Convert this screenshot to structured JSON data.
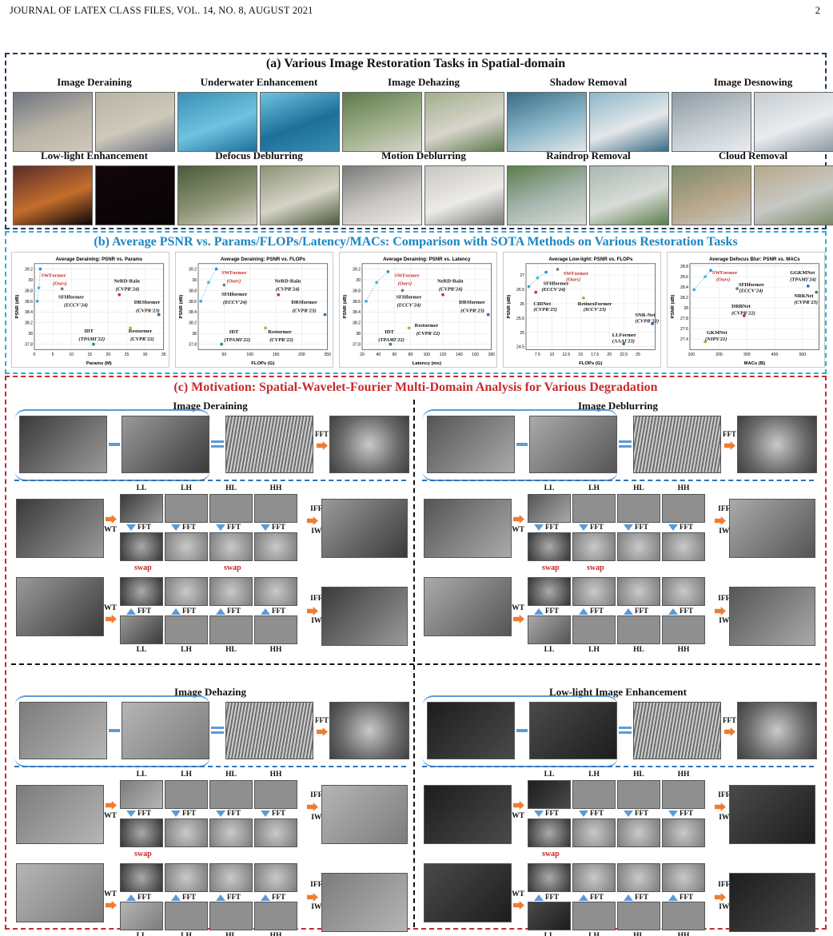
{
  "header": {
    "journal": "JOURNAL OF LATEX CLASS FILES, VOL. 14, NO. 8, AUGUST 2021",
    "page": "2"
  },
  "sectionA": {
    "title": "(a) Various Image Restoration Tasks in Spatial-domain",
    "tasks": [
      "Image Deraining",
      "Underwater Enhancement",
      "Image Dehazing",
      "Shadow Removal",
      "Image Desnowing",
      "Low-light Enhancement",
      "Defocus Deblurring",
      "Motion Deblurring",
      "Raindrop Removal",
      "Cloud Removal"
    ]
  },
  "sectionB": {
    "title": "(b) Average PSNR vs. Params/FLOPs/Latency/MACs: Comparison with SOTA Methods on Various Restoration Tasks"
  },
  "chart_data": [
    {
      "type": "scatter",
      "title": "Average Deraining: PSNR vs. Params",
      "xlabel": "Params (M)",
      "ylabel": "PSNR (dB)",
      "xlim": [
        0,
        35
      ],
      "ylim": [
        37.7,
        39.3
      ],
      "xticks": [
        0,
        5,
        10,
        15,
        20,
        25,
        30,
        35
      ],
      "yticks": [
        37.8,
        38.0,
        38.2,
        38.4,
        38.6,
        38.8,
        39.0,
        39.2
      ],
      "points": [
        {
          "x": 0.8,
          "y": 38.6
        },
        {
          "x": 1.2,
          "y": 38.85
        },
        {
          "x": 1.6,
          "y": 39.2
        },
        {
          "x": 7.5,
          "y": 38.83
        },
        {
          "x": 23,
          "y": 38.72
        },
        {
          "x": 26,
          "y": 38.1
        },
        {
          "x": 33.7,
          "y": 38.35
        },
        {
          "x": 16,
          "y": 37.8
        }
      ],
      "labels": [
        {
          "t": "SWFormer",
          "r": true,
          "x": 1.8,
          "y": 39.05
        },
        {
          "t": "(Ours)",
          "r": true,
          "i": true,
          "x": 5,
          "y": 38.9
        },
        {
          "t": "SFHformer",
          "x": 6.5,
          "y": 38.65
        },
        {
          "t": "(ECCV'24)",
          "i": true,
          "x": 8,
          "y": 38.5
        },
        {
          "t": "NeRD-Rain",
          "x": 21.5,
          "y": 38.95
        },
        {
          "t": "(CVPR'24)",
          "i": true,
          "x": 22,
          "y": 38.8
        },
        {
          "t": "DRSformer",
          "x": 27,
          "y": 38.55
        },
        {
          "t": "(CVPR'23)",
          "i": true,
          "x": 27.5,
          "y": 38.4
        },
        {
          "t": "IDT",
          "x": 13.5,
          "y": 38.02
        },
        {
          "t": "(TPAMI'22)",
          "i": true,
          "x": 12,
          "y": 37.87
        },
        {
          "t": "Restormer",
          "x": 25.5,
          "y": 38.02
        },
        {
          "t": "(CVPR'22)",
          "i": true,
          "x": 26,
          "y": 37.87
        }
      ]
    },
    {
      "type": "scatter",
      "title": "Average Deraining: PSNR vs. FLOPs",
      "xlabel": "FLOPs (G)",
      "ylabel": "PSNR (dB)",
      "xlim": [
        0,
        250
      ],
      "ylim": [
        37.7,
        39.3
      ],
      "xticks": [
        50,
        100,
        150,
        200,
        250
      ],
      "yticks": [
        37.8,
        38.0,
        38.2,
        38.4,
        38.6,
        38.8,
        39.0,
        39.2
      ],
      "points": [
        {
          "x": 5,
          "y": 38.6
        },
        {
          "x": 20,
          "y": 38.95
        },
        {
          "x": 35,
          "y": 39.2
        },
        {
          "x": 50,
          "y": 38.9
        },
        {
          "x": 155,
          "y": 38.72
        },
        {
          "x": 130,
          "y": 38.1
        },
        {
          "x": 245,
          "y": 38.35
        },
        {
          "x": 45,
          "y": 37.8
        }
      ],
      "labels": [
        {
          "t": "SWFormer",
          "r": true,
          "x": 45,
          "y": 39.1
        },
        {
          "t": "(Ours)",
          "r": true,
          "i": true,
          "x": 55,
          "y": 38.95
        },
        {
          "t": "SFHformer",
          "x": 45,
          "y": 38.7
        },
        {
          "t": "(ECCV'24)",
          "i": true,
          "x": 48,
          "y": 38.55
        },
        {
          "t": "NeRD-Rain",
          "x": 148,
          "y": 38.95
        },
        {
          "t": "(CVPR'24)",
          "i": true,
          "x": 150,
          "y": 38.8
        },
        {
          "t": "DRSformer",
          "x": 180,
          "y": 38.55
        },
        {
          "t": "(CVPR'23)",
          "i": true,
          "x": 182,
          "y": 38.4
        },
        {
          "t": "IDT",
          "x": 60,
          "y": 38.0
        },
        {
          "t": "(TPAMI'22)",
          "i": true,
          "x": 50,
          "y": 37.85
        },
        {
          "t": "Restormer",
          "x": 135,
          "y": 38.0
        },
        {
          "t": "(CVPR'22)",
          "i": true,
          "x": 138,
          "y": 37.85
        }
      ]
    },
    {
      "type": "scatter",
      "title": "Average Deraining: PSNR vs. Latency",
      "xlabel": "Latency (ms)",
      "ylabel": "PSNR (dB)",
      "xlim": [
        20,
        180
      ],
      "ylim": [
        37.7,
        39.3
      ],
      "xticks": [
        20,
        40,
        60,
        80,
        100,
        120,
        140,
        160,
        180
      ],
      "yticks": [
        37.8,
        38.0,
        38.2,
        38.4,
        38.6,
        38.8,
        39.0,
        39.2
      ],
      "points": [
        {
          "x": 25,
          "y": 38.6
        },
        {
          "x": 38,
          "y": 38.95
        },
        {
          "x": 52,
          "y": 39.15
        },
        {
          "x": 70,
          "y": 38.8
        },
        {
          "x": 120,
          "y": 38.72
        },
        {
          "x": 78,
          "y": 38.1
        },
        {
          "x": 176,
          "y": 38.35
        },
        {
          "x": 55,
          "y": 37.8
        }
      ],
      "labels": [
        {
          "t": "SWFormer",
          "r": true,
          "x": 60,
          "y": 39.05
        },
        {
          "t": "(Ours)",
          "r": true,
          "i": true,
          "x": 64,
          "y": 38.9
        },
        {
          "t": "SFHformer",
          "x": 62,
          "y": 38.65
        },
        {
          "t": "(ECCV'24)",
          "i": true,
          "x": 63,
          "y": 38.5
        },
        {
          "t": "NeRD-Rain",
          "x": 113,
          "y": 38.95
        },
        {
          "t": "(CVPR'24)",
          "i": true,
          "x": 115,
          "y": 38.8
        },
        {
          "t": "DRSformer",
          "x": 140,
          "y": 38.55
        },
        {
          "t": "(CVPR'23)",
          "i": true,
          "x": 142,
          "y": 38.4
        },
        {
          "t": "IDT",
          "x": 48,
          "y": 38.0
        },
        {
          "t": "(TPAMI'22)",
          "i": true,
          "x": 40,
          "y": 37.85
        },
        {
          "t": "Restormer",
          "x": 85,
          "y": 38.12
        },
        {
          "t": "(CVPR'22)",
          "i": true,
          "x": 87,
          "y": 37.97
        }
      ]
    },
    {
      "type": "scatter",
      "title": "Average Low-light: PSNR vs. FLOPs",
      "xlabel": "FLOPs (G)",
      "ylabel": "PSNR (dB)",
      "xlim": [
        5.5,
        28
      ],
      "ylim": [
        24.4,
        27.4
      ],
      "xticks": [
        7.5,
        10.0,
        12.5,
        15.0,
        17.5,
        20.0,
        22.5,
        25.0
      ],
      "yticks": [
        24.5,
        25.0,
        25.5,
        26.0,
        26.5,
        27.0
      ],
      "points": [
        {
          "x": 6,
          "y": 26.6
        },
        {
          "x": 7.5,
          "y": 26.9
        },
        {
          "x": 9,
          "y": 27.1
        },
        {
          "x": 11,
          "y": 27.2
        },
        {
          "x": 7.2,
          "y": 26.4
        },
        {
          "x": 15.5,
          "y": 26.2
        },
        {
          "x": 27.5,
          "y": 25.3
        },
        {
          "x": 22.5,
          "y": 24.6
        }
      ],
      "labels": [
        {
          "t": "SFHformer",
          "x": 8.5,
          "y": 26.65
        },
        {
          "t": "(ECCV'24)",
          "i": true,
          "x": 8.2,
          "y": 26.45
        },
        {
          "t": "SWFormer",
          "r": true,
          "x": 12,
          "y": 27.0
        },
        {
          "t": "(Ours)",
          "r": true,
          "i": true,
          "x": 12.5,
          "y": 26.8
        },
        {
          "t": "CIDNet",
          "x": 6.8,
          "y": 25.95
        },
        {
          "t": "(CVPR'25)",
          "i": true,
          "x": 6.8,
          "y": 25.75
        },
        {
          "t": "RetinexFormer",
          "x": 14.5,
          "y": 25.95
        },
        {
          "t": "(ICCV'23)",
          "i": true,
          "x": 15.5,
          "y": 25.75
        },
        {
          "t": "SNR-Net",
          "x": 24.5,
          "y": 25.55
        },
        {
          "t": "(CVPR'22)",
          "i": true,
          "x": 24.5,
          "y": 25.35
        },
        {
          "t": "LLFormer",
          "x": 20.5,
          "y": 24.85
        },
        {
          "t": "(AAAI'23)",
          "i": true,
          "x": 20.5,
          "y": 24.65
        }
      ]
    },
    {
      "type": "scatter",
      "title": "Average Defocus Blur: PSNR vs. MACs",
      "xlabel": "MACs (B)",
      "ylabel": "PSNR (dB)",
      "xlim": [
        95,
        560
      ],
      "ylim": [
        27.2,
        28.85
      ],
      "xticks": [
        100,
        200,
        300,
        400,
        500
      ],
      "yticks": [
        27.4,
        27.6,
        27.8,
        28.0,
        28.2,
        28.4,
        28.6,
        28.8
      ],
      "points": [
        {
          "x": 110,
          "y": 28.35
        },
        {
          "x": 150,
          "y": 28.6
        },
        {
          "x": 170,
          "y": 28.72
        },
        {
          "x": 265,
          "y": 28.37
        },
        {
          "x": 290,
          "y": 27.85
        },
        {
          "x": 150,
          "y": 27.35
        },
        {
          "x": 520,
          "y": 28.42
        },
        {
          "x": 550,
          "y": 28.3
        }
      ],
      "labels": [
        {
          "t": "SWFormer",
          "r": true,
          "x": 175,
          "y": 28.65
        },
        {
          "t": "(Ours)",
          "r": true,
          "i": true,
          "x": 190,
          "y": 28.52
        },
        {
          "t": "SFHformer",
          "x": 270,
          "y": 28.42
        },
        {
          "t": "(ECCV'24)",
          "i": true,
          "x": 272,
          "y": 28.3
        },
        {
          "t": "GGKMNet",
          "x": 455,
          "y": 28.65
        },
        {
          "t": "(TPAMI'24)",
          "i": true,
          "x": 455,
          "y": 28.52
        },
        {
          "t": "NRKNet",
          "x": 470,
          "y": 28.2
        },
        {
          "t": "(CVPR'23)",
          "i": true,
          "x": 470,
          "y": 28.08
        },
        {
          "t": "DRBNet",
          "x": 245,
          "y": 28.0
        },
        {
          "t": "(CVPR'22)",
          "i": true,
          "x": 245,
          "y": 27.87
        },
        {
          "t": "GKMNet",
          "x": 155,
          "y": 27.5
        },
        {
          "t": "(NIPS'21)",
          "i": true,
          "x": 150,
          "y": 27.37
        }
      ]
    }
  ],
  "sectionC": {
    "title": "(c) Motivation: Spatial-Wavelet-Fourier Multi-Domain Analysis for Various Degradation",
    "subs": [
      "Image Deraining",
      "Image Deblurring",
      "Image Dehazing",
      "Low-light Image Enhancement"
    ],
    "bands": [
      "LL",
      "LH",
      "HL",
      "HH"
    ],
    "ops": {
      "wt": "WT",
      "iwt": "IWT",
      "fft": "FFT",
      "ifft": "IFFT",
      "swap": "swap"
    }
  },
  "colors": {
    "red": "#c62b2b",
    "blue": "#2ab0d8",
    "navy": "#22395e",
    "orange": "#ee7d31",
    "arrowBlue": "#5b9bd5"
  }
}
